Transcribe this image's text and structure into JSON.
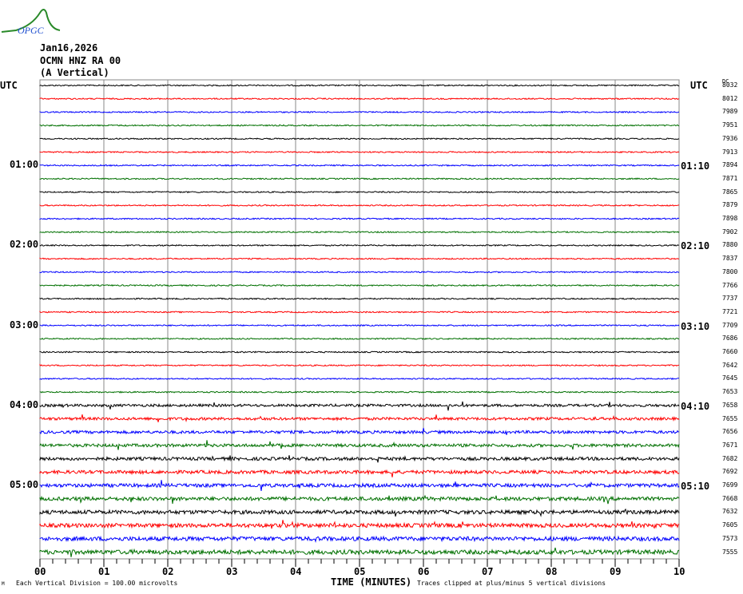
{
  "logo_text": "OPGC",
  "header": {
    "date": "Jan16,2026",
    "station": "OCMN HNZ RA 00",
    "component": "(A Vertical)"
  },
  "left_axis": {
    "title": "UTC",
    "labels": [
      "01:00",
      "02:00",
      "03:00",
      "04:00",
      "05:00"
    ]
  },
  "right_axis": {
    "title": "UTC",
    "dc_title": "DC",
    "labels": [
      "01:10",
      "02:10",
      "03:10",
      "04:10",
      "05:10"
    ]
  },
  "footer": {
    "corner": "M",
    "scale": "Each Vertical Division =  100.00 microvolts",
    "xlabel": "TIME (MINUTES)",
    "clip": "Traces clipped at plus/minus 5 vertical divisions"
  },
  "chart_data": {
    "type": "line",
    "title": "Jan16,2026 OCMN HNZ RA 00 (A Vertical)",
    "xlabel": "TIME (MINUTES)",
    "ylabel": "UTC",
    "xlim": [
      0,
      10
    ],
    "x_ticks": [
      "00",
      "01",
      "02",
      "03",
      "04",
      "05",
      "06",
      "07",
      "08",
      "09",
      "10"
    ],
    "trace_minutes": 10,
    "colors": [
      "#000000",
      "#ff0000",
      "#0000ff",
      "#007000"
    ],
    "dc_offsets": [
      8032,
      8012,
      7989,
      7951,
      7936,
      7913,
      7894,
      7871,
      7865,
      7879,
      7898,
      7902,
      7880,
      7837,
      7800,
      7766,
      7737,
      7721,
      7709,
      7686,
      7660,
      7642,
      7645,
      7653,
      7658,
      7655,
      7656,
      7671,
      7682,
      7692,
      7699,
      7668,
      7632,
      7605,
      7573,
      7555
    ],
    "grid": true
  }
}
